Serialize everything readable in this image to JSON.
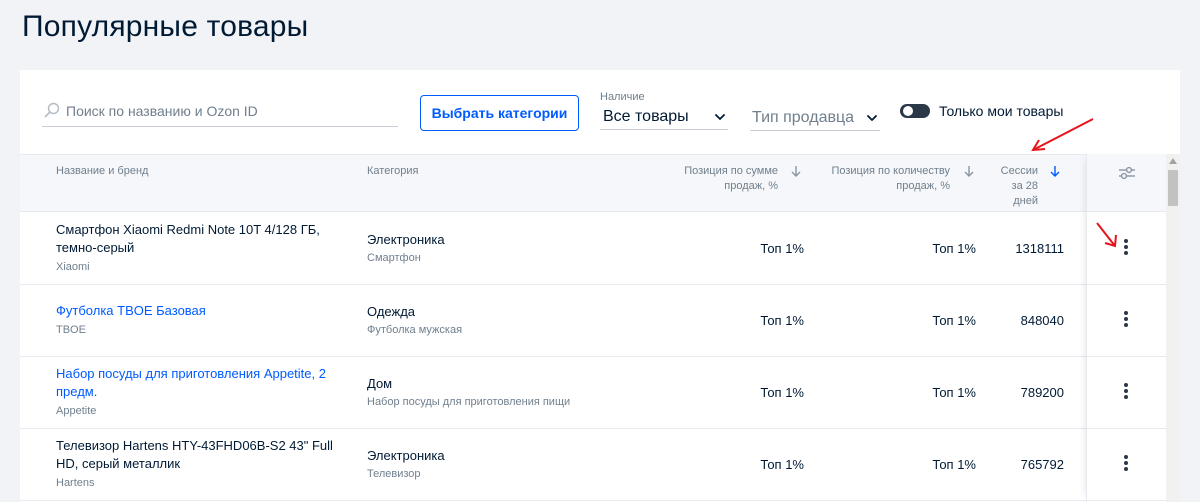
{
  "page": {
    "title": "Популярные товары"
  },
  "filters": {
    "search_placeholder": "Поиск по названию и Ozon ID",
    "categories_button": "Выбрать категории",
    "availability_label": "Наличие",
    "availability_value": "Все товары",
    "seller_type_placeholder": "Тип продавца",
    "only_mine_label": "Только мои товары",
    "only_mine_enabled": false
  },
  "table": {
    "columns": {
      "name": "Название и бренд",
      "category": "Категория",
      "sales_sum_position": [
        "Позиция по сумме",
        "продаж, %"
      ],
      "sales_qty_position": [
        "Позиция по количеству",
        "продаж, %"
      ],
      "sessions": [
        "Сессии",
        "за 28",
        "дней"
      ]
    },
    "rows": [
      {
        "name": [
          "Смартфон Xiaomi Redmi Note 10T 4/128 ГБ,",
          "темно-серый"
        ],
        "is_link": false,
        "brand": "Xiaomi",
        "category": "Электроника",
        "subcategory": "Смартфон",
        "sales_sum_position": "Топ 1%",
        "sales_qty_position": "Топ 1%",
        "sessions": "1318111"
      },
      {
        "name": [
          "Футболка TBOE Базовая"
        ],
        "is_link": true,
        "brand": "TBOE",
        "category": "Одежда",
        "subcategory": "Футболка мужская",
        "sales_sum_position": "Топ 1%",
        "sales_qty_position": "Топ 1%",
        "sessions": "848040"
      },
      {
        "name": [
          "Набор посуды для приготовления Appetite, 2",
          "предм."
        ],
        "is_link": true,
        "brand": "Appetite",
        "category": "Дом",
        "subcategory": "Набор посуды для приготовления пищи",
        "sales_sum_position": "Топ 1%",
        "sales_qty_position": "Топ 1%",
        "sessions": "789200"
      },
      {
        "name": [
          "Телевизор Hartens HTY-43FHD06B-S2 43\" Full",
          "HD, серый металлик"
        ],
        "is_link": false,
        "brand": "Hartens",
        "category": "Электроника",
        "subcategory": "Телевизор",
        "sales_sum_position": "Топ 1%",
        "sales_qty_position": "Топ 1%",
        "sessions": "765792"
      }
    ]
  },
  "colors": {
    "accent": "#005bff",
    "text": "#001a34",
    "muted": "#707f8d",
    "annotation": "#e8141d"
  },
  "icons": {
    "search": "search-icon",
    "chevron": "chevron-down-icon",
    "sort": "arrow-down-icon",
    "settings": "sliders-icon",
    "row_menu": "more-vertical-icon"
  }
}
